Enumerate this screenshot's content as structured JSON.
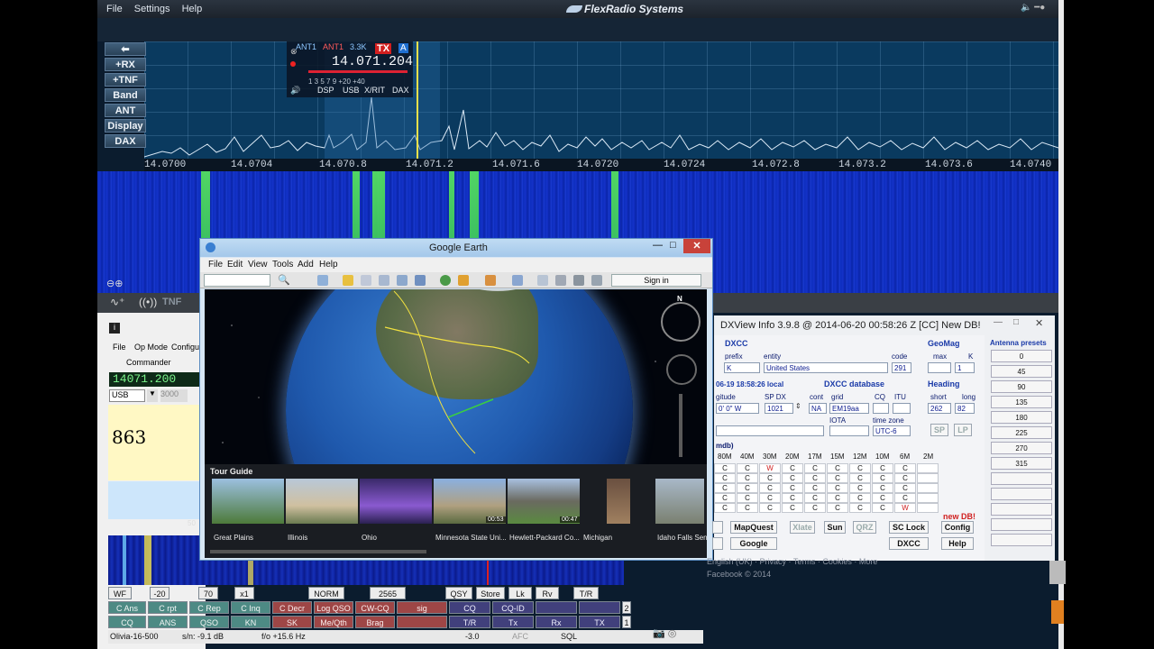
{
  "flex": {
    "menu": [
      "File",
      "Settings",
      "Help"
    ],
    "brand": "FlexRadio Systems",
    "side_buttons": [
      "⬅",
      "+RX",
      "+TNF",
      "Band",
      "ANT",
      "Display",
      "DAX"
    ],
    "freq_ticks": [
      "14.0700",
      "14.0704",
      "14.070.8",
      "14.071.2",
      "14.071.6",
      "14.0720",
      "14.0724",
      "14.072.8",
      "14.073.2",
      "14.073.6",
      "14.0740"
    ],
    "slice": {
      "ant1": "ANT1",
      "ant1_tx": "ANT1",
      "rx_ant": "3.3K",
      "tx_label": "TX",
      "slice_letter": "A",
      "frequency": "14.071.204",
      "scale": "1 3 5 7 9 +20 +40",
      "labels": [
        "DSP",
        "USB",
        "X/RIT",
        "DAX"
      ]
    },
    "toolbar_label": "TNF"
  },
  "fldigi": {
    "menu": [
      "File",
      "Op Mode",
      "Configu"
    ],
    "commander": "Commander",
    "rx_freq": "14071.200",
    "mode": "USB",
    "bw": "3000",
    "rx_text": "863",
    "wf_marker": "50",
    "row1": [
      {
        "label": "WF",
        "c": "w"
      },
      {
        "label": "-20",
        "c": "w"
      },
      {
        "label": "70",
        "c": "w"
      },
      {
        "label": "x1",
        "c": "w"
      },
      {
        "label": "NORM",
        "c": "w"
      },
      {
        "label": "2565",
        "c": "w"
      },
      {
        "label": "QSY",
        "c": "w"
      },
      {
        "label": "Store",
        "c": "w"
      },
      {
        "label": "Lk",
        "c": "w"
      },
      {
        "label": "Rv",
        "c": "w"
      },
      {
        "label": "T/R",
        "c": "w"
      }
    ],
    "row2": [
      {
        "label": "C Ans",
        "c": "g"
      },
      {
        "label": "C rpt",
        "c": "g"
      },
      {
        "label": "C Rep",
        "c": "g"
      },
      {
        "label": "C Inq",
        "c": "g"
      },
      {
        "label": "C Decr",
        "c": "r"
      },
      {
        "label": "Log QSO",
        "c": "r"
      },
      {
        "label": "CW-CQ",
        "c": "r"
      },
      {
        "label": "sig",
        "c": "r"
      },
      {
        "label": "CQ",
        "c": "b"
      },
      {
        "label": "CQ-ID",
        "c": "b"
      },
      {
        "label": "",
        "c": "b"
      },
      {
        "label": "",
        "c": "b"
      },
      {
        "label": "2",
        "c": "w"
      }
    ],
    "row3": [
      {
        "label": "CQ",
        "c": "g"
      },
      {
        "label": "ANS",
        "c": "g"
      },
      {
        "label": "QSO",
        "c": "g"
      },
      {
        "label": "KN",
        "c": "g"
      },
      {
        "label": "SK",
        "c": "r"
      },
      {
        "label": "Me/Qth",
        "c": "r"
      },
      {
        "label": "Brag",
        "c": "r"
      },
      {
        "label": "",
        "c": "r"
      },
      {
        "label": "T/R",
        "c": "b"
      },
      {
        "label": "Tx",
        "c": "b"
      },
      {
        "label": "Rx",
        "c": "b"
      },
      {
        "label": "TX",
        "c": "b"
      },
      {
        "label": "1",
        "c": "w"
      }
    ],
    "status": {
      "mode": "Olivia-16-500",
      "sn": "s/n: -9.1 dB",
      "fo": "f/o +15.6 Hz",
      "level": "-3.0",
      "afc": "AFC",
      "sql": "SQL"
    }
  },
  "earth": {
    "title": "Google Earth",
    "menu": [
      "File",
      "Edit",
      "View",
      "Tools",
      "Add",
      "Help"
    ],
    "sign_in": "Sign in",
    "compass_n": "N",
    "tour_heading": "Tour Guide",
    "tours": [
      {
        "caption": "Great Plains",
        "duration": ""
      },
      {
        "caption": "Illinois",
        "duration": ""
      },
      {
        "caption": "Ohio",
        "duration": ""
      },
      {
        "caption": "Minnesota State Uni...",
        "duration": "00:53"
      },
      {
        "caption": "Hewlett-Packard Co...",
        "duration": "00:47"
      },
      {
        "caption": "Michigan",
        "duration": ""
      },
      {
        "caption": "Idaho Falls Sen",
        "duration": ""
      }
    ]
  },
  "dxview": {
    "title": "DXView Info 3.9.8 @ 2014-06-20  00:58:26 Z  [CC] New DB!",
    "dxcc_heading": "DXCC",
    "prefix_label": "prefix",
    "prefix": "K",
    "entity_label": "entity",
    "entity": "United States",
    "code_label": "code",
    "code": "291",
    "geomag_heading": "GeoMag",
    "max_label": "max",
    "k_label": "K",
    "k_value": "1",
    "local_time": "06-19 18:58:26 local",
    "db_heading": "DXCC database",
    "longitude_label": "gitude",
    "longitude": "0' 0\" W",
    "spdx_label": "SP DX",
    "spdx": "1021",
    "cont_label": "cont",
    "cont": "NA",
    "grid_label": "grid",
    "grid": "EM19aa",
    "cq_label": "CQ",
    "itu_label": "ITU",
    "iota_label": "IOTA",
    "tz_label": "time zone",
    "tz": "UTC-6",
    "heading_heading": "Heading",
    "short_label": "short",
    "long_label": "long",
    "short": "262",
    "long": "82",
    "sp": "SP",
    "lp": "LP",
    "grid_title": "mdb)",
    "bands": [
      "80M",
      "40M",
      "30M",
      "20M",
      "17M",
      "15M",
      "12M",
      "10M",
      "6M",
      "2M"
    ],
    "band_rows": [
      [
        "C",
        "C",
        "W",
        "C",
        "C",
        "C",
        "C",
        "C",
        "C",
        ""
      ],
      [
        "C",
        "C",
        "C",
        "C",
        "C",
        "C",
        "C",
        "C",
        "C",
        ""
      ],
      [
        "C",
        "C",
        "C",
        "C",
        "C",
        "C",
        "C",
        "C",
        "C",
        ""
      ],
      [
        "C",
        "C",
        "C",
        "C",
        "C",
        "C",
        "C",
        "C",
        "C",
        ""
      ],
      [
        "C",
        "C",
        "C",
        "C",
        "C",
        "C",
        "C",
        "C",
        "W",
        ""
      ]
    ],
    "new_db": "new DB!",
    "buttons": {
      "mapquest": "MapQuest",
      "xlate": "Xlate",
      "sun": "Sun",
      "qrz": "QRZ",
      "sclock": "SC Lock",
      "config": "Config",
      "google": "Google",
      "dxcc": "DXCC",
      "help": "Help"
    },
    "antenna_heading": "Antenna presets",
    "antenna_presets": [
      "0",
      "45",
      "90",
      "135",
      "180",
      "225",
      "270",
      "315",
      "",
      "",
      "",
      "",
      ""
    ]
  },
  "facebook": {
    "links": "English (UK) · Privacy · Terms · Cookies · More",
    "copyright": "Facebook © 2014"
  }
}
